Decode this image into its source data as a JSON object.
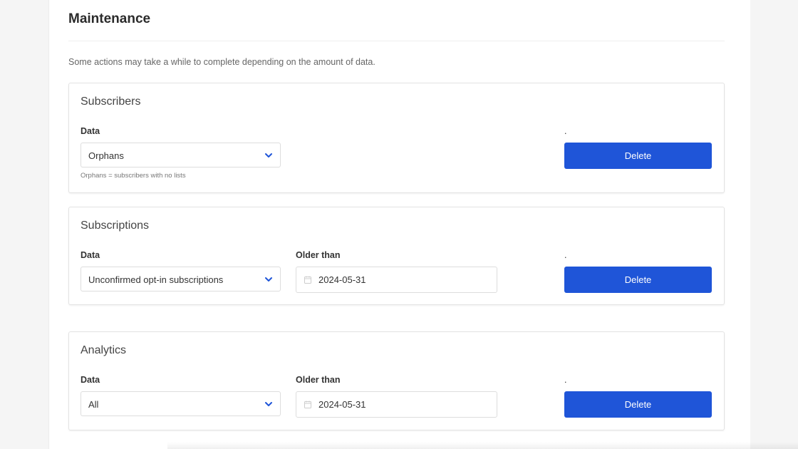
{
  "page": {
    "title": "Maintenance",
    "intro": "Some actions may take a while to complete depending on the amount of data."
  },
  "subscribers": {
    "title": "Subscribers",
    "data_label": "Data",
    "data_value": "Orphans",
    "help": "Orphans = subscribers with no lists",
    "action_label": ".",
    "delete_label": "Delete"
  },
  "subscriptions": {
    "title": "Subscriptions",
    "data_label": "Data",
    "data_value": "Unconfirmed opt-in subscriptions",
    "older_label": "Older than",
    "older_value": "2024-05-31",
    "action_label": ".",
    "delete_label": "Delete"
  },
  "analytics": {
    "title": "Analytics",
    "data_label": "Data",
    "data_value": "All",
    "older_label": "Older than",
    "older_value": "2024-05-31",
    "action_label": ".",
    "delete_label": "Delete"
  },
  "icons": {
    "dropdown": "chevron-down-icon",
    "date": "calendar-icon"
  },
  "colors": {
    "primary": "#1f55d8",
    "chevron": "#1f55d8"
  }
}
